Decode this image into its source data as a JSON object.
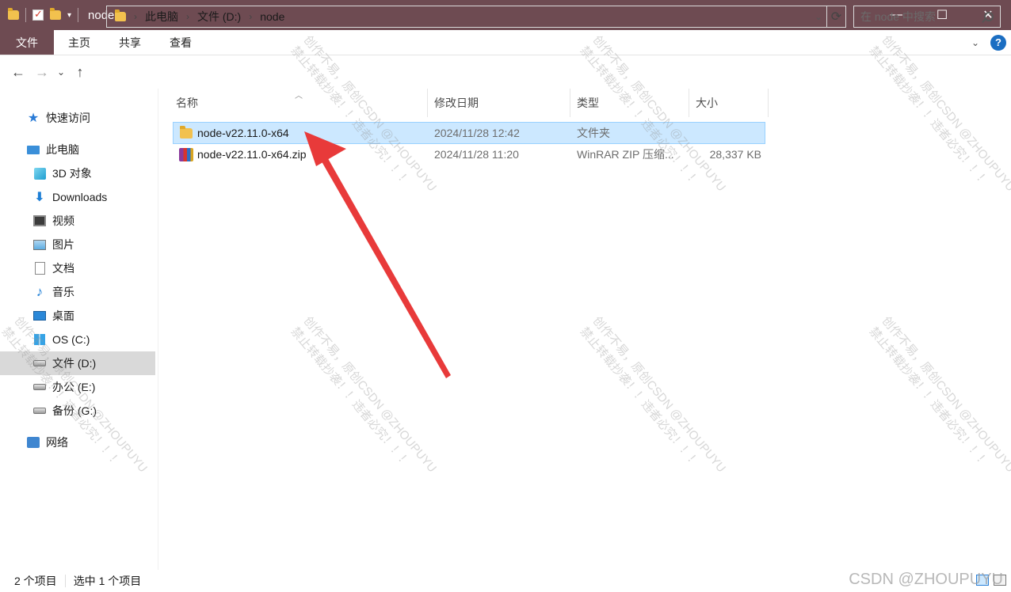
{
  "titlebar": {
    "title": "node",
    "minimize": "—",
    "maximize": "☐",
    "close": "✕"
  },
  "ribbon": {
    "tabs": [
      "文件",
      "主页",
      "共享",
      "查看"
    ],
    "expand": "⌄",
    "help": "?"
  },
  "nav": {
    "back": "←",
    "forward": "→",
    "recent": "⌄",
    "up": "↑",
    "breadcrumb": [
      "此电脑",
      "文件 (D:)",
      "node"
    ],
    "refresh": "⟳",
    "search_placeholder": "在 node 中搜索"
  },
  "sidebar": {
    "items": [
      {
        "label": "快速访问",
        "icon": "star-icon"
      },
      {
        "label": "此电脑",
        "icon": "computer-icon"
      },
      {
        "label": "3D 对象",
        "icon": "3d-objects-icon"
      },
      {
        "label": "Downloads",
        "icon": "download-icon"
      },
      {
        "label": "视频",
        "icon": "video-icon"
      },
      {
        "label": "图片",
        "icon": "picture-icon"
      },
      {
        "label": "文档",
        "icon": "document-icon"
      },
      {
        "label": "音乐",
        "icon": "music-icon"
      },
      {
        "label": "桌面",
        "icon": "desktop-icon"
      },
      {
        "label": "OS (C:)",
        "icon": "windows-drive-icon"
      },
      {
        "label": "文件 (D:)",
        "icon": "drive-icon"
      },
      {
        "label": "办公 (E:)",
        "icon": "drive-icon"
      },
      {
        "label": "备份 (G:)",
        "icon": "drive-icon"
      },
      {
        "label": "网络",
        "icon": "network-icon"
      }
    ]
  },
  "columns": {
    "name": "名称",
    "date": "修改日期",
    "type": "类型",
    "size": "大小"
  },
  "files": [
    {
      "name": "node-v22.11.0-x64",
      "date": "2024/11/28 12:42",
      "type": "文件夹",
      "size": "",
      "icon": "folder-icon",
      "selected": true
    },
    {
      "name": "node-v22.11.0-x64.zip",
      "date": "2024/11/28 11:20",
      "type": "WinRAR ZIP 压缩...",
      "size": "28,337 KB",
      "icon": "winrar-icon",
      "selected": false
    }
  ],
  "status": {
    "count": "2 个项目",
    "selection": "选中 1 个项目"
  },
  "watermark": {
    "line1": "创作不易，原创CSDN @ZHOUPUYU",
    "line2": "禁止转载抄袭！！违者必究！！！",
    "csdn": "CSDN @ZHOUPUYU"
  },
  "colors": {
    "titlebar": "#6e4b52",
    "selection": "#cce8ff",
    "arrow": "#e83a3a"
  }
}
